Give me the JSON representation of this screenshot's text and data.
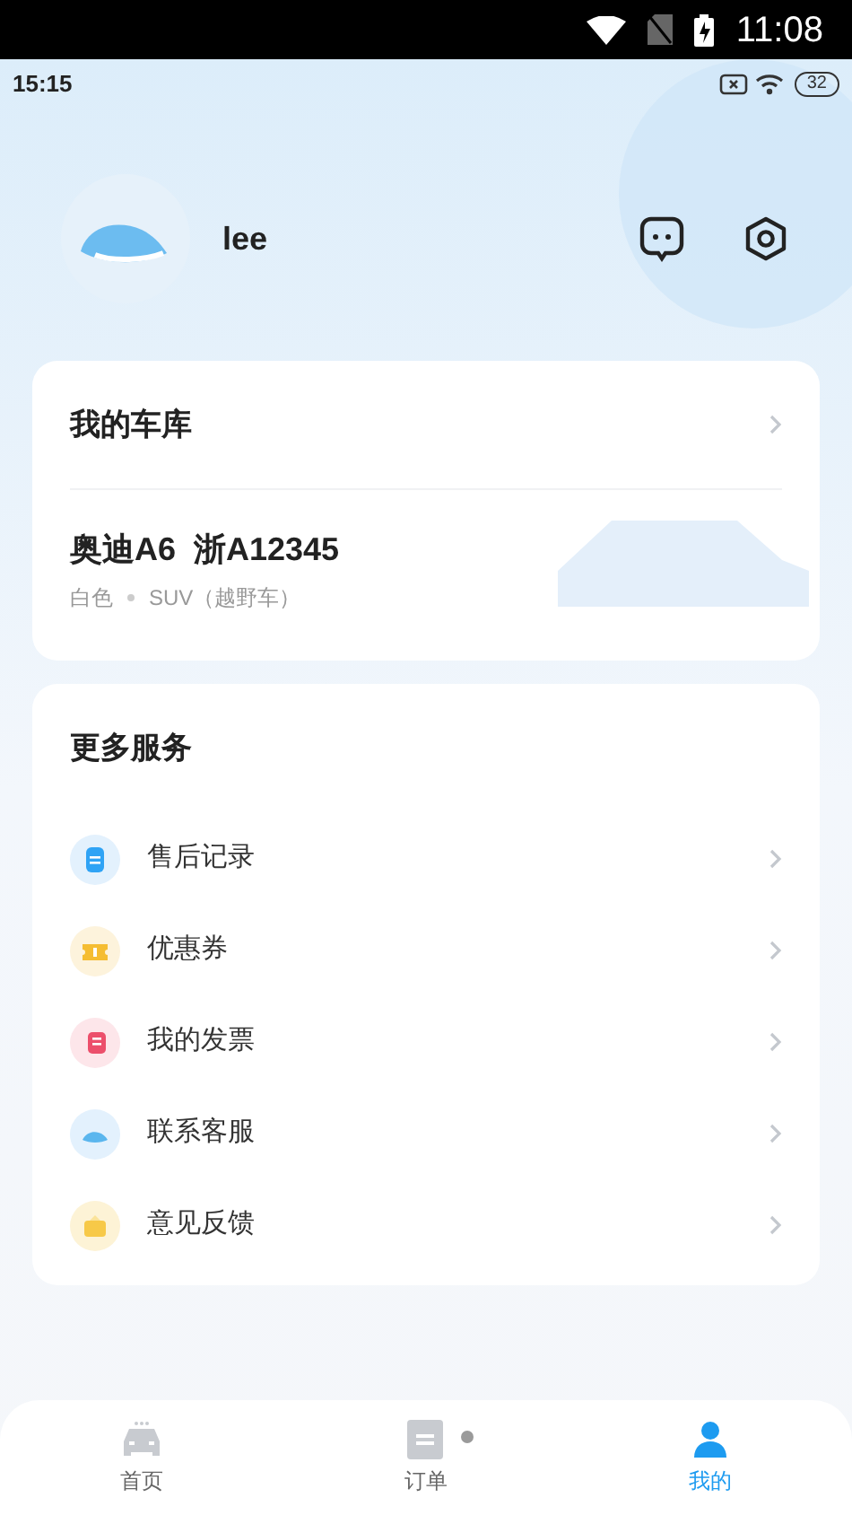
{
  "system_status_bar": {
    "time": "11:08"
  },
  "app_status_bar": {
    "time": "15:15",
    "battery": "32"
  },
  "profile": {
    "username": "lee"
  },
  "garage": {
    "title": "我的车库",
    "car_name": "奥迪A6  浙A12345",
    "paint": "白色",
    "type": "SUV（越野车）"
  },
  "services": {
    "title": "更多服务",
    "items": [
      {
        "kind": "record",
        "label": "售后记录"
      },
      {
        "kind": "coupon",
        "label": "优惠券"
      },
      {
        "kind": "invoice",
        "label": "我的发票"
      },
      {
        "kind": "support",
        "label": "联系客服"
      },
      {
        "kind": "feedback",
        "label": "意见反馈"
      }
    ]
  },
  "bottom_nav": [
    {
      "kind": "home",
      "label": "首页",
      "selected": false,
      "dot": false
    },
    {
      "kind": "orders",
      "label": "订单",
      "selected": false,
      "dot": true
    },
    {
      "kind": "mine",
      "label": "我的",
      "selected": true,
      "dot": false
    }
  ]
}
